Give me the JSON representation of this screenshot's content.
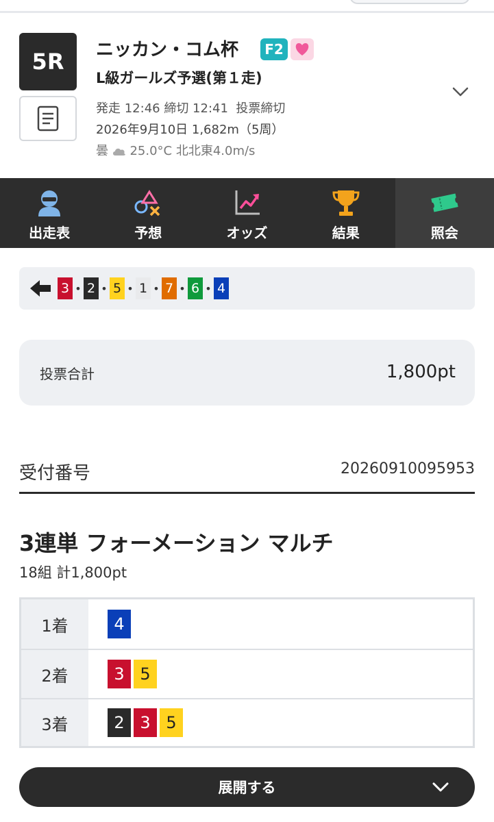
{
  "race": {
    "number": "5R",
    "title": "ニッカン・コム杯",
    "grade_tag": "F2",
    "subtitle": "L級ガールズ予選(第１走)",
    "start_label": "発走 12:46 締切 12:41",
    "status": "投票締切",
    "date_distance": "2026年9月10日 1,682m（5周）",
    "weather_label": "曇",
    "weather_detail": "25.0°C 北北東4.0m/s"
  },
  "nav": {
    "items": [
      {
        "label": "出走表",
        "icon": "rider-icon"
      },
      {
        "label": "予想",
        "icon": "prediction-icon"
      },
      {
        "label": "オッズ",
        "icon": "odds-chart-icon"
      },
      {
        "label": "結果",
        "icon": "trophy-icon"
      },
      {
        "label": "照会",
        "icon": "ticket-icon",
        "active": true
      }
    ]
  },
  "order": {
    "sep": "•",
    "boxes": [
      {
        "num": "3",
        "color": "#c8102e"
      },
      {
        "num": "2",
        "color": "#2a2a2a"
      },
      {
        "num": "5",
        "color": "#ffd21f"
      },
      {
        "num": "1",
        "color": "#e9eaec"
      },
      {
        "num": "7",
        "color": "#e06c00"
      },
      {
        "num": "6",
        "color": "#0f9a3c"
      },
      {
        "num": "4",
        "color": "#0a3fb8"
      }
    ]
  },
  "total": {
    "label": "投票合計",
    "value": "1,800pt"
  },
  "receipt": {
    "label": "受付番号",
    "number": "20260910095953"
  },
  "bet": {
    "title": "3連単 フォーメーション マルチ",
    "summary": "18組 計1,800pt",
    "rows": [
      {
        "place": "1着",
        "nums": [
          "4"
        ]
      },
      {
        "place": "2着",
        "nums": [
          "3",
          "5"
        ]
      },
      {
        "place": "3着",
        "nums": [
          "2",
          "3",
          "5"
        ]
      }
    ]
  },
  "expand": {
    "label": "展開する"
  },
  "colors": {
    "frame1": "#e9eaec",
    "frame2": "#2a2a2a",
    "frame3": "#c8102e",
    "frame4": "#0a3fb8",
    "frame5": "#ffd21f",
    "frame6": "#0f9a3c",
    "frame7": "#e06c00",
    "brand_dark": "#2d2d2d"
  }
}
